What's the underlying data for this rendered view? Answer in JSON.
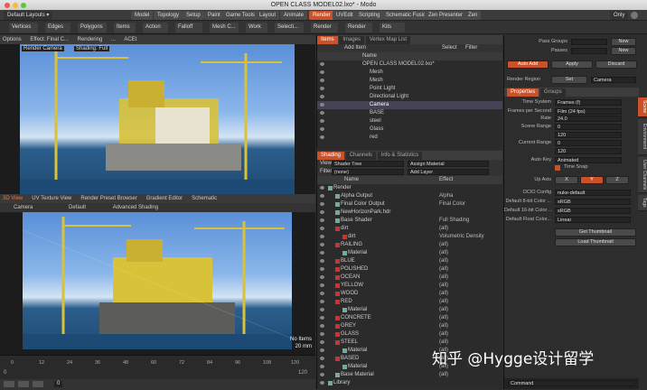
{
  "window": {
    "title": "OPEN CLASS MODEL02.lxo* - Modo"
  },
  "layoutbar": {
    "default_layouts": "Default Layouts ▾",
    "only": "Only",
    "tabs": [
      "Model",
      "Topology",
      "Setup",
      "Paint",
      "Game Tools",
      "Layout",
      "Animate",
      "Render",
      "UVEdit",
      "Scripting",
      "Schematic Fusion",
      "Zen Presenter",
      "Zen"
    ]
  },
  "toolbar": {
    "items": [
      "Vertices",
      "Edges",
      "Polygons",
      "Items",
      "Action",
      "Falloff",
      "Mesh C...",
      "Work",
      "Selecti...",
      "Render",
      "Render",
      "Kits"
    ]
  },
  "viewport_top": {
    "tabs": [
      "Options",
      "Effect: Final C...",
      "Rendering",
      "...",
      "ACEt"
    ],
    "camera": "Render Camera",
    "shading": "Shading: Full"
  },
  "viewport_bottom": {
    "tabs": [
      "3D View",
      "UV Texture View",
      "Render Preset Browser",
      "Gradient Editor",
      "Schematic"
    ],
    "camera": "Camera",
    "style": "Default",
    "shading": "Advanced Shading",
    "readout_top": "No Items",
    "readout_bottom": "20 mm"
  },
  "timeline": {
    "ticks": [
      "0",
      "12",
      "24",
      "36",
      "48",
      "60",
      "72",
      "84",
      "96",
      "108",
      "120"
    ],
    "start": "0",
    "end": "120",
    "frame": "0"
  },
  "items_panel": {
    "tabs": [
      "Items",
      "Images",
      "Vertex Map List"
    ],
    "add_item": "Add Item",
    "select": "Select",
    "filter": "Filter",
    "col_name": "Name",
    "rows": [
      "OPEN CLASS MODEL02.lxo*",
      "Mesh",
      "Mesh",
      "Point Light",
      "Directional Light",
      "Camera",
      "BASE",
      "steel",
      "Glass",
      "red"
    ]
  },
  "shading_panel": {
    "tabs": [
      "Shading",
      "Channels",
      "Info & Statistics"
    ],
    "view_label": "View",
    "view_value": "Shader Tree",
    "assign": "Assign Material",
    "filter_label": "Filter",
    "filter_value": "(none)",
    "add_layer": "Add Layer",
    "col_name": "Name",
    "col_effect": "Effect",
    "rows": [
      [
        "Render",
        ""
      ],
      [
        "Alpha Output",
        "Alpha"
      ],
      [
        "Final Color Output",
        "Final Color"
      ],
      [
        "NewHorizonPark.hdr",
        ""
      ],
      [
        "Base Shader",
        "Full Shading"
      ],
      [
        "dirt",
        "(all)"
      ],
      [
        "dirt",
        "Volumetric Density"
      ],
      [
        "RAILING",
        "(all)"
      ],
      [
        "Material",
        "(all)"
      ],
      [
        "BLUE",
        "(all)"
      ],
      [
        "POLISHED",
        "(all)"
      ],
      [
        "OCEAN",
        "(all)"
      ],
      [
        "YELLOW",
        "(all)"
      ],
      [
        "WOOD",
        "(all)"
      ],
      [
        "RED",
        "(all)"
      ],
      [
        "Material",
        "(all)"
      ],
      [
        "CONCRETE",
        "(all)"
      ],
      [
        "GREY",
        "(all)"
      ],
      [
        "GLASS",
        "(all)"
      ],
      [
        "STEEL",
        "(all)"
      ],
      [
        "Material",
        "(all)"
      ],
      [
        "BASED",
        "(all)"
      ],
      [
        "Material",
        "(all)"
      ],
      [
        "Base Material",
        "(all)"
      ],
      [
        "Library",
        ""
      ]
    ]
  },
  "right_panel": {
    "pass_groups": "Pass Groups",
    "passes": "Passes",
    "new": "New",
    "auto_add": "Auto Add",
    "apply": "Apply",
    "discard": "Discard",
    "render_region": "Render Region",
    "set": "Set",
    "camera": "Camera",
    "tabs": [
      "Properties",
      "Groups"
    ],
    "props": [
      [
        "Time System",
        "Frames (f)"
      ],
      [
        "Frames per Second",
        "Film (24 fps)"
      ],
      [
        "Rate",
        "24.0"
      ],
      [
        "Scene Range",
        "0"
      ],
      [
        "",
        "120"
      ],
      [
        "Current Range",
        "0"
      ],
      [
        "",
        "120"
      ],
      [
        "Auto Key",
        "Animated"
      ]
    ],
    "time_snap": "Time Snap",
    "up_axis_label": "Up Axis",
    "up_axis": [
      "X",
      "Y",
      "Z"
    ],
    "ocio": [
      [
        "OCIO Config",
        "nuke-default"
      ],
      [
        "Default 8-bit Color ...",
        "sRGB"
      ],
      [
        "Default 16-bit Color ...",
        "sRGB"
      ],
      [
        "Default Float Color...",
        "Linear"
      ]
    ],
    "get_thumb": "Get Thumbnail",
    "load_thumb": "Load Thumbnail",
    "command": "Command"
  },
  "side_tabs": [
    "Scene",
    "Environment",
    "User Channels",
    "Tags"
  ],
  "watermark": "知乎 @Hygge设计留学",
  "colors": {
    "accent": "#c9522a",
    "bg": "#2e2e2e"
  }
}
